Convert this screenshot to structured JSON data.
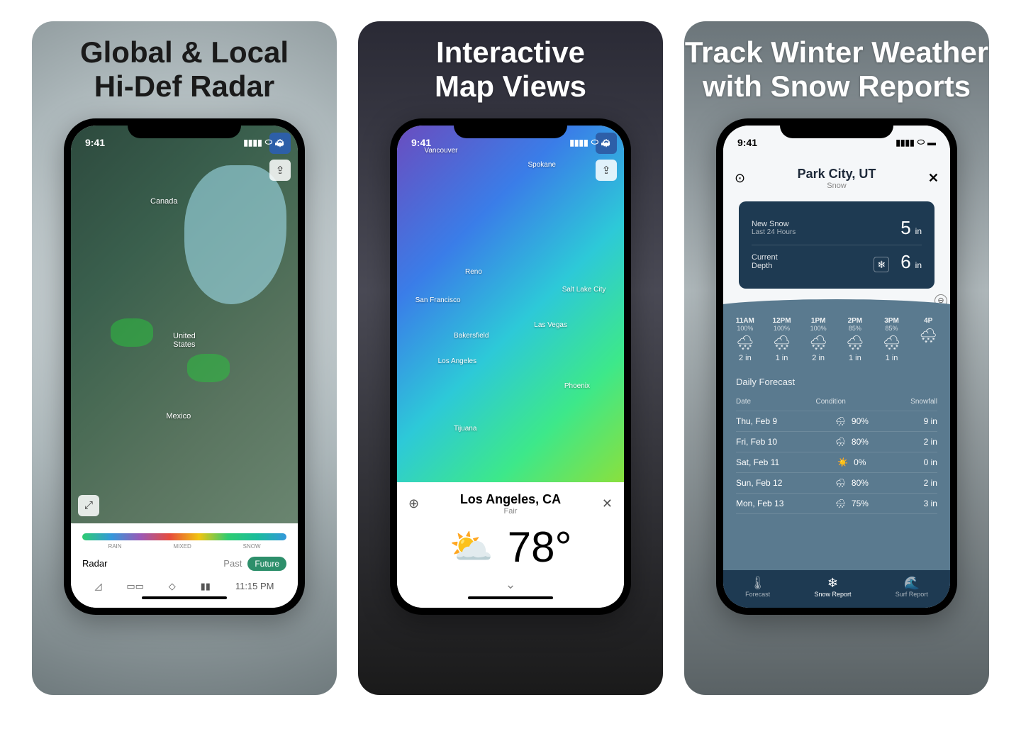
{
  "screenshots": [
    {
      "titleLine1": "Global & Local",
      "titleLine2": "Hi-Def Radar"
    },
    {
      "titleLine1": "Interactive",
      "titleLine2": "Map Views"
    },
    {
      "titleLine1": "Track Winter Weather",
      "titleLine2": "with Snow Reports"
    }
  ],
  "status": {
    "time": "9:41"
  },
  "s1": {
    "mapLabels": {
      "canada": "Canada",
      "us": "United\nStates",
      "mexico": "Mexico"
    },
    "spectrum": {
      "rain": "RAIN",
      "mixed": "MIXED",
      "snow": "SNOW"
    },
    "radarRow": {
      "label": "Radar",
      "past": "Past",
      "future": "Future"
    },
    "toolbar": {
      "time": "11:15 PM"
    }
  },
  "s2": {
    "labels": {
      "sf": "San Francisco",
      "lv": "Las Vegas",
      "la": "Los Angeles",
      "px": "Phoenix",
      "slc": "Salt Lake City",
      "bak": "Bakersfield",
      "van": "Vancouver",
      "spo": "Spokane",
      "reno": "Reno",
      "tij": "Tijuana"
    },
    "location": {
      "name": "Los Angeles, CA",
      "condition": "Fair",
      "temp": "78°"
    }
  },
  "s3": {
    "location": {
      "name": "Park City, UT",
      "sub": "Snow"
    },
    "newSnow": {
      "label": "New Snow",
      "sub": "Last 24 Hours",
      "val": "5",
      "unit": "in"
    },
    "depth": {
      "label": "Current\nDepth",
      "val": "6",
      "unit": "in"
    },
    "hourly": [
      {
        "t": "11AM",
        "pc": "100%",
        "v": "2 in"
      },
      {
        "t": "12PM",
        "pc": "100%",
        "v": "1 in"
      },
      {
        "t": "1PM",
        "pc": "100%",
        "v": "2 in"
      },
      {
        "t": "2PM",
        "pc": "85%",
        "v": "1 in"
      },
      {
        "t": "3PM",
        "pc": "85%",
        "v": "1 in"
      },
      {
        "t": "4P",
        "pc": "",
        "v": ""
      }
    ],
    "dailyTitle": "Daily Forecast",
    "dailyHeaders": {
      "date": "Date",
      "condition": "Condition",
      "snowfall": "Snowfall"
    },
    "daily": [
      {
        "d": "Thu, Feb 9",
        "i": "🌨",
        "p": "90%",
        "s": "9 in"
      },
      {
        "d": "Fri, Feb 10",
        "i": "🌨",
        "p": "80%",
        "s": "2 in"
      },
      {
        "d": "Sat, Feb 11",
        "i": "☀️",
        "p": "0%",
        "s": "0 in"
      },
      {
        "d": "Sun, Feb 12",
        "i": "🌨",
        "p": "80%",
        "s": "2 in"
      },
      {
        "d": "Mon, Feb 13",
        "i": "🌨",
        "p": "75%",
        "s": "3 in"
      }
    ],
    "tabs": {
      "forecast": "Forecast",
      "snow": "Snow Report",
      "surf": "Surf Report"
    }
  }
}
